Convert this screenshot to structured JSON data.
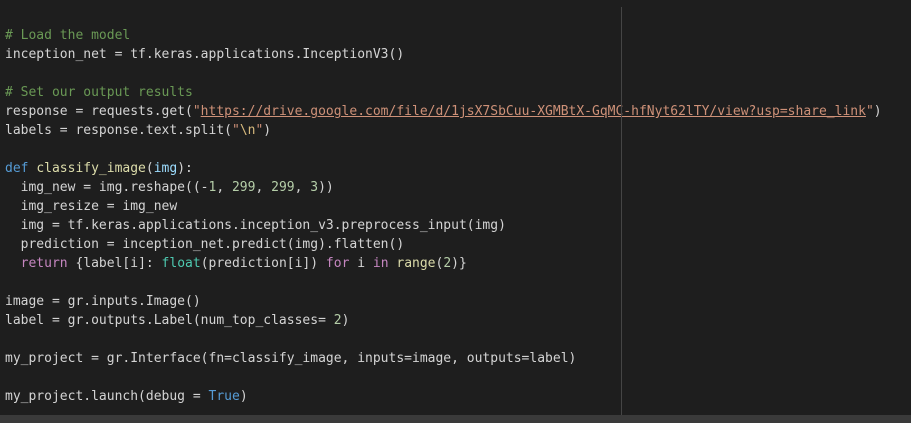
{
  "colors": {
    "background": "#1e1e1e",
    "comment": "#6a9955",
    "string": "#ce9178",
    "keyword": "#569cd6",
    "control": "#c586c0",
    "function": "#dcdcaa",
    "builtin": "#4ec9b0",
    "number": "#b5cea8",
    "param": "#9cdcfe",
    "plain": "#d4d4d4"
  },
  "code": {
    "lines": [
      {
        "tokens": [
          {
            "t": "# Load the model",
            "c": "comment"
          }
        ]
      },
      {
        "tokens": [
          {
            "t": "inception_net = tf.keras.applications.InceptionV3()",
            "c": "plain"
          }
        ]
      },
      {
        "tokens": []
      },
      {
        "tokens": [
          {
            "t": "# Set our output results",
            "c": "comment"
          }
        ]
      },
      {
        "tokens": [
          {
            "t": "response = requests.get(",
            "c": "plain"
          },
          {
            "t": "\"",
            "c": "string"
          },
          {
            "t": "https://drive.google.com/file/d/1jsX7SbCuu-XGMBtX-GqMC-hfNyt62lTY/view?usp=share_link",
            "c": "string link"
          },
          {
            "t": "\"",
            "c": "string"
          },
          {
            "t": ")",
            "c": "plain"
          }
        ]
      },
      {
        "tokens": [
          {
            "t": "labels = response.text.split(",
            "c": "plain"
          },
          {
            "t": "\"",
            "c": "string"
          },
          {
            "t": "\\n",
            "c": "escape"
          },
          {
            "t": "\"",
            "c": "string"
          },
          {
            "t": ")",
            "c": "plain"
          }
        ]
      },
      {
        "tokens": []
      },
      {
        "tokens": [
          {
            "t": "def ",
            "c": "keyword"
          },
          {
            "t": "classify_image",
            "c": "function"
          },
          {
            "t": "(",
            "c": "plain"
          },
          {
            "t": "img",
            "c": "param"
          },
          {
            "t": "):",
            "c": "plain"
          }
        ]
      },
      {
        "tokens": [
          {
            "t": "  img_new = img.reshape((-",
            "c": "plain"
          },
          {
            "t": "1",
            "c": "number"
          },
          {
            "t": ", ",
            "c": "plain"
          },
          {
            "t": "299",
            "c": "number"
          },
          {
            "t": ", ",
            "c": "plain"
          },
          {
            "t": "299",
            "c": "number"
          },
          {
            "t": ", ",
            "c": "plain"
          },
          {
            "t": "3",
            "c": "number"
          },
          {
            "t": "))",
            "c": "plain"
          }
        ]
      },
      {
        "tokens": [
          {
            "t": "  img_resize = img_new",
            "c": "plain"
          }
        ]
      },
      {
        "tokens": [
          {
            "t": "  img = tf.keras.applications.inception_v3.preprocess_input(img)",
            "c": "plain"
          }
        ]
      },
      {
        "tokens": [
          {
            "t": "  prediction = inception_net.predict(img).flatten()",
            "c": "plain"
          }
        ]
      },
      {
        "tokens": [
          {
            "t": "  ",
            "c": "plain"
          },
          {
            "t": "return",
            "c": "control"
          },
          {
            "t": " {label[i]: ",
            "c": "plain"
          },
          {
            "t": "float",
            "c": "builtin"
          },
          {
            "t": "(prediction[i]) ",
            "c": "plain"
          },
          {
            "t": "for",
            "c": "control"
          },
          {
            "t": " i ",
            "c": "plain"
          },
          {
            "t": "in",
            "c": "control"
          },
          {
            "t": " ",
            "c": "plain"
          },
          {
            "t": "range",
            "c": "function"
          },
          {
            "t": "(",
            "c": "plain"
          },
          {
            "t": "2",
            "c": "number"
          },
          {
            "t": ")}",
            "c": "plain"
          }
        ]
      },
      {
        "tokens": []
      },
      {
        "tokens": [
          {
            "t": "image = gr.inputs.Image()",
            "c": "plain"
          }
        ]
      },
      {
        "tokens": [
          {
            "t": "label = gr.outputs.Label(num_top_classes= ",
            "c": "plain"
          },
          {
            "t": "2",
            "c": "number"
          },
          {
            "t": ")",
            "c": "plain"
          }
        ]
      },
      {
        "tokens": []
      },
      {
        "tokens": [
          {
            "t": "my_project = gr.Interface(fn=classify_image, inputs=image, outputs=label)",
            "c": "plain"
          }
        ]
      },
      {
        "tokens": []
      },
      {
        "tokens": [
          {
            "t": "my_project.launch(debug = ",
            "c": "plain"
          },
          {
            "t": "True",
            "c": "keyword"
          },
          {
            "t": ")",
            "c": "plain"
          }
        ]
      }
    ]
  }
}
